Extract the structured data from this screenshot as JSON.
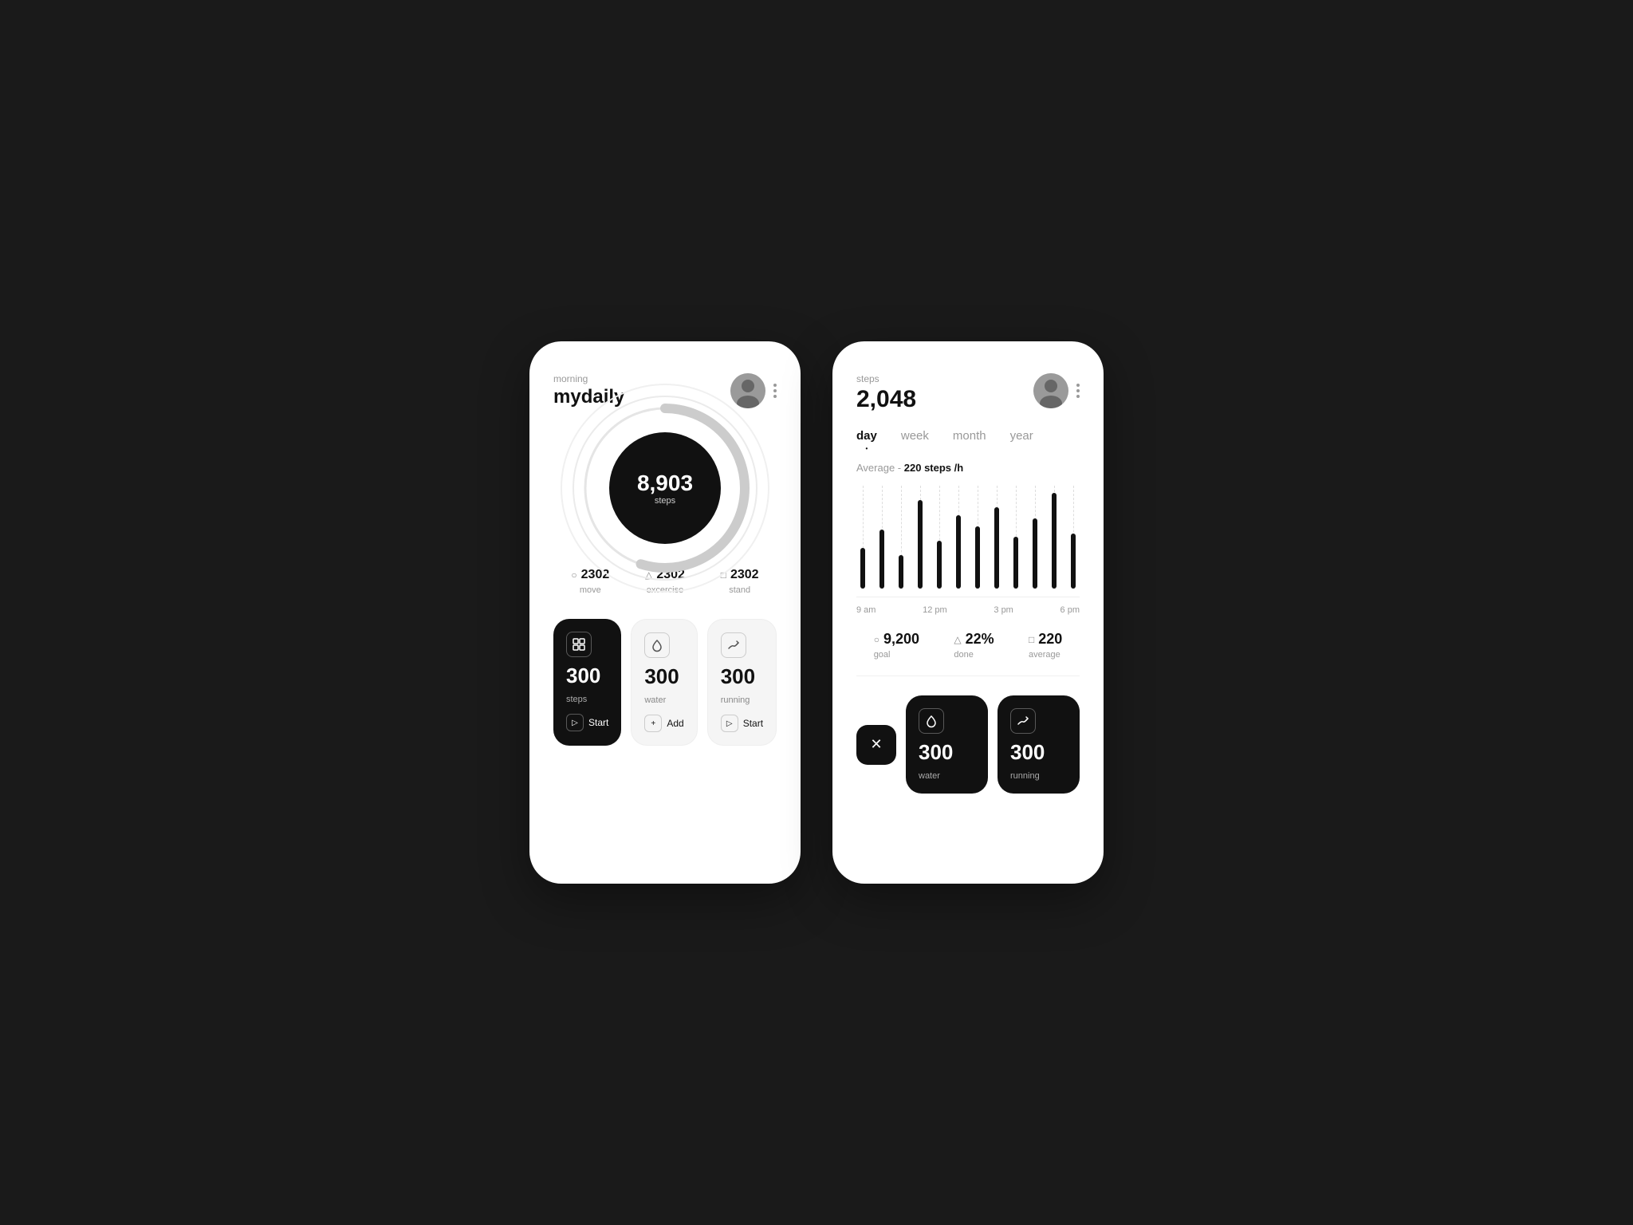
{
  "left_phone": {
    "greeting": "morning",
    "title": "mydaily",
    "ring": {
      "value": "8,903",
      "label": "steps"
    },
    "stats": [
      {
        "icon": "○",
        "value": "2302",
        "label": "move"
      },
      {
        "icon": "△",
        "value": "2302",
        "label": "excercise"
      },
      {
        "icon": "□",
        "value": "2302",
        "label": "stand"
      }
    ],
    "cards": [
      {
        "type": "dark",
        "icon": "⊞",
        "value": "300",
        "sublabel": "steps",
        "action_icon": "▷",
        "action_label": "Start"
      },
      {
        "type": "light",
        "icon": "◎",
        "value": "300",
        "sublabel": "water",
        "action_icon": "+",
        "action_label": "Add"
      },
      {
        "type": "light",
        "icon": "⇄",
        "value": "300",
        "sublabel": "running",
        "action_icon": "▷",
        "action_label": "Start"
      }
    ]
  },
  "right_phone": {
    "label": "steps",
    "value": "2,048",
    "period_tabs": [
      {
        "label": "day",
        "active": true
      },
      {
        "label": "week",
        "active": false
      },
      {
        "label": "month",
        "active": false
      },
      {
        "label": "year",
        "active": false
      }
    ],
    "avg_prefix": "Average -",
    "avg_value": "220 steps /h",
    "chart": {
      "bars": [
        55,
        80,
        45,
        120,
        65,
        100,
        85,
        110,
        70,
        95,
        130,
        75
      ],
      "labels": [
        "9 am",
        "12 pm",
        "3 pm",
        "6 pm"
      ]
    },
    "bottom_stats": [
      {
        "icon": "○",
        "value": "9,200",
        "label": "goal"
      },
      {
        "icon": "△",
        "value": "22%",
        "label": "done"
      },
      {
        "icon": "□",
        "value": "220",
        "label": "average"
      }
    ],
    "bottom_cards": [
      {
        "type": "dark",
        "icon": "◎",
        "value": "300",
        "sublabel": "water"
      },
      {
        "type": "dark",
        "icon": "⇄",
        "value": "300",
        "sublabel": "running"
      }
    ],
    "x_button": "✕"
  }
}
